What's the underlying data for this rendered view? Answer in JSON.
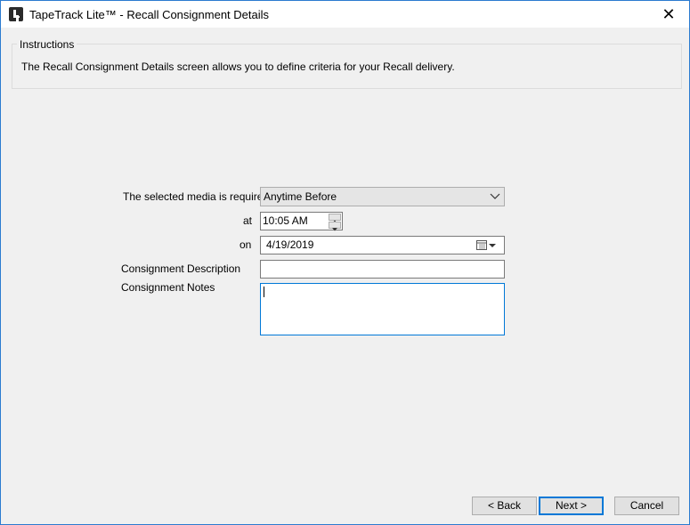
{
  "window": {
    "title": "TapeTrack Lite™ - Recall Consignment Details",
    "close_glyph": "✕"
  },
  "instructions": {
    "title": "Instructions",
    "text": "The Recall Consignment Details screen allows you to define criteria for your Recall delivery."
  },
  "form": {
    "required_label": "The selected media is required",
    "required_value": "Anytime Before",
    "at_label": "at",
    "time_value": "10:05 AM",
    "on_label": "on",
    "date_value": "4/19/2019",
    "description_label": "Consignment Description",
    "description_value": "",
    "notes_label": "Consignment Notes",
    "notes_value": ""
  },
  "buttons": {
    "back": "< Back",
    "next": "Next >",
    "cancel": "Cancel"
  },
  "icons": {
    "app": "tapetrack-logo-icon",
    "calendar": "calendar-icon",
    "dropdown": "chevron-down-icon"
  },
  "colors": {
    "accent": "#0078d7",
    "window_border": "#2b7bd0",
    "background": "#f0f0f0"
  }
}
